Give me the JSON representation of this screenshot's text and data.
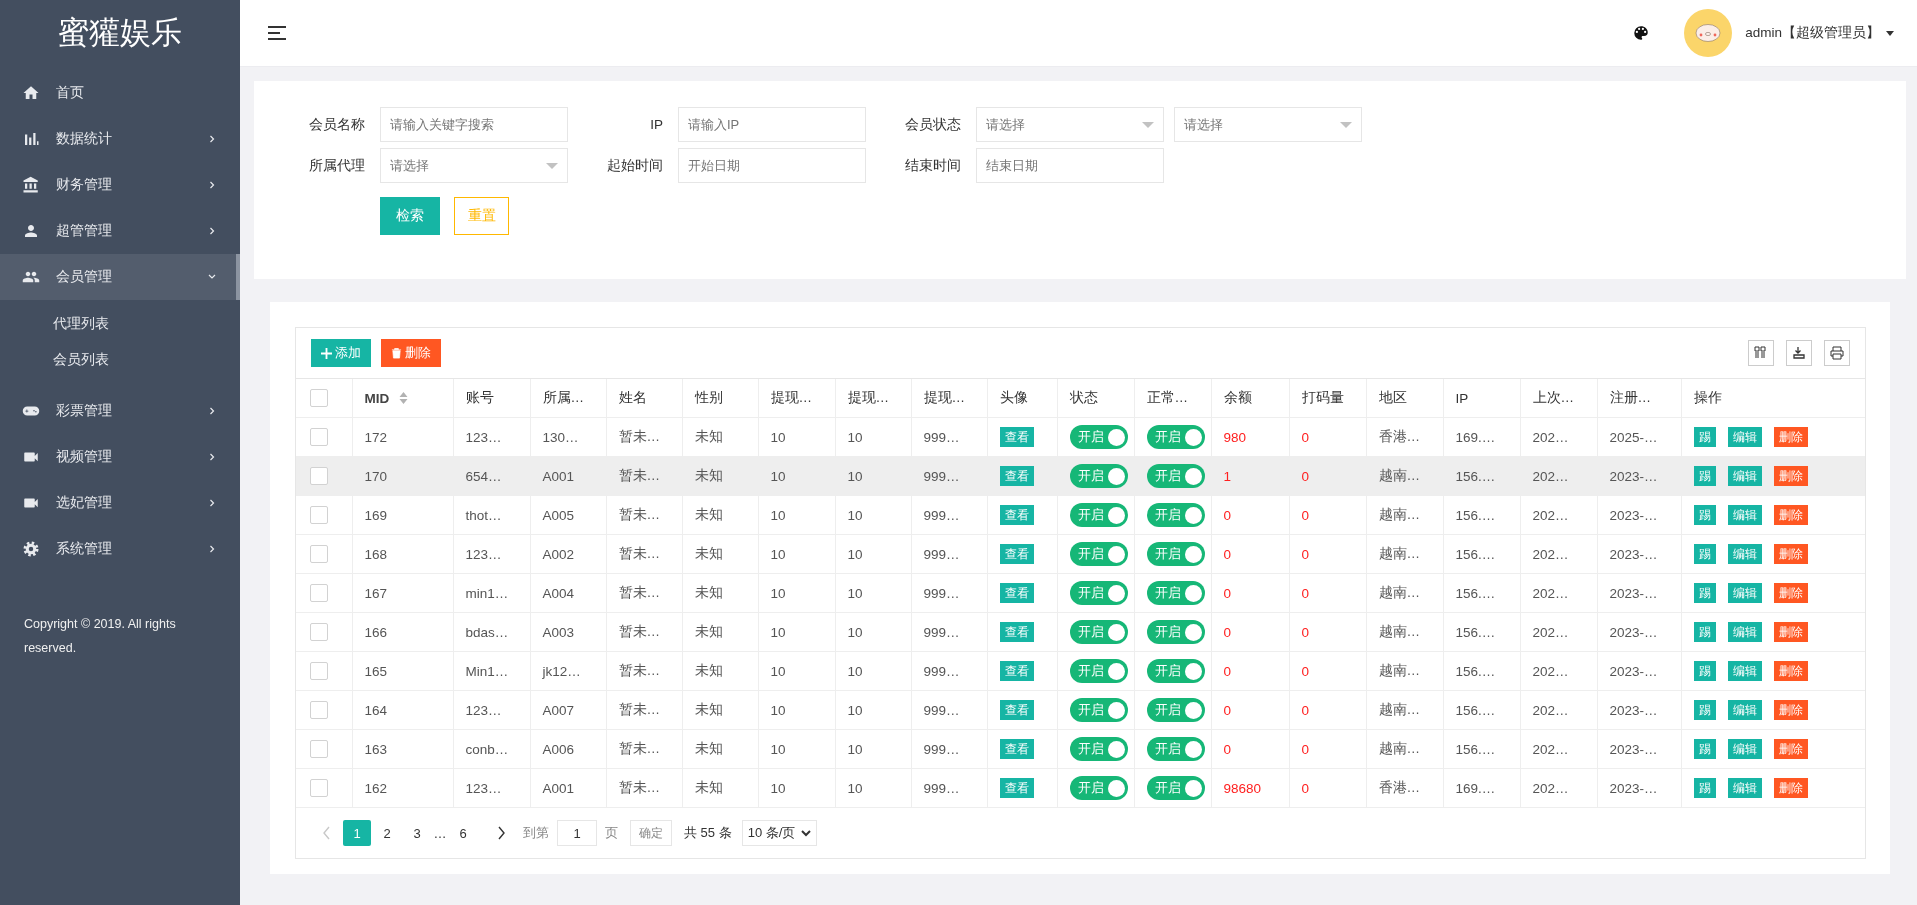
{
  "brand": "蜜獾娱乐",
  "sidebar": {
    "items": [
      {
        "kind": "home",
        "label": "首页",
        "selected": false
      },
      {
        "kind": "bar-chart",
        "label": "数据统计",
        "expanded": false,
        "selected": false
      },
      {
        "kind": "bank",
        "label": "财务管理",
        "expanded": false,
        "selected": false
      },
      {
        "kind": "user",
        "label": "超管管理",
        "expanded": false,
        "selected": false
      },
      {
        "kind": "users",
        "label": "会员管理",
        "expanded": true,
        "selected": true,
        "children": [
          {
            "label": "代理列表",
            "selected": false
          },
          {
            "label": "会员列表",
            "selected": false
          }
        ]
      },
      {
        "kind": "gamepad",
        "label": "彩票管理",
        "expanded": false,
        "selected": false
      },
      {
        "kind": "video",
        "label": "视频管理",
        "expanded": false,
        "selected": false
      },
      {
        "kind": "video",
        "label": "选妃管理",
        "expanded": false,
        "selected": false
      },
      {
        "kind": "gear",
        "label": "系统管理",
        "expanded": false,
        "selected": false
      }
    ],
    "copyright": "Copyright © 2019. All rights reserved."
  },
  "header": {
    "user": "admin【超级管理员】"
  },
  "filters": {
    "rows": [
      [
        {
          "label": "会员名称",
          "kind": "input",
          "placeholder": "请输入关键字搜索"
        },
        {
          "label": "IP",
          "kind": "input",
          "placeholder": "请输入IP"
        },
        {
          "label": "会员状态",
          "kind": "select",
          "placeholder": "请选择"
        },
        {
          "kind": "select",
          "placeholder": "请选择"
        }
      ],
      [
        {
          "label": "所属代理",
          "kind": "select",
          "placeholder": "请选择"
        },
        {
          "label": "起始时间",
          "kind": "input",
          "placeholder": "开始日期"
        },
        {
          "label": "结束时间",
          "kind": "input",
          "placeholder": "结束日期"
        }
      ]
    ],
    "buttons": [
      {
        "label": "检索",
        "kind": "primary"
      },
      {
        "label": "重置",
        "kind": "outline"
      }
    ]
  },
  "toolbar": {
    "buttons": [
      {
        "label": "添加",
        "kind": "add"
      },
      {
        "label": "删除",
        "kind": "delete"
      }
    ]
  },
  "table": {
    "header_checked": false,
    "columns": [
      {
        "label": "MID",
        "kind": "text",
        "sortable": true
      },
      {
        "label": "账号",
        "kind": "text"
      },
      {
        "label": "所属…",
        "kind": "text"
      },
      {
        "label": "姓名",
        "kind": "text"
      },
      {
        "label": "性别",
        "kind": "text"
      },
      {
        "label": "提现…",
        "kind": "text"
      },
      {
        "label": "提现…",
        "kind": "text"
      },
      {
        "label": "提现…",
        "kind": "text"
      },
      {
        "label": "头像",
        "kind": "button"
      },
      {
        "label": "状态",
        "kind": "toggle"
      },
      {
        "label": "正常…",
        "kind": "toggle"
      },
      {
        "label": "余额",
        "kind": "red"
      },
      {
        "label": "打码量",
        "kind": "red"
      },
      {
        "label": "地区",
        "kind": "text"
      },
      {
        "label": "IP",
        "kind": "text"
      },
      {
        "label": "上次…",
        "kind": "text"
      },
      {
        "label": "注册…",
        "kind": "text"
      },
      {
        "label": "操作",
        "kind": "actions"
      }
    ],
    "rows": [
      {
        "checked": false,
        "hovered": false,
        "cells": [
          "172",
          "123…",
          "130…",
          "暂未…",
          "未知",
          "10",
          "10",
          "999…",
          "查看",
          {
            "label": "开启",
            "on": true
          },
          {
            "label": "开启",
            "on": true
          },
          "980",
          "0",
          "香港…",
          "169.…",
          "202…",
          "2025-…",
          [
            {
              "label": "踢",
              "kind": "normal"
            },
            {
              "label": "编辑",
              "kind": "normal"
            },
            {
              "label": "删除",
              "kind": "danger"
            }
          ]
        ]
      },
      {
        "checked": false,
        "hovered": true,
        "cells": [
          "170",
          "654…",
          "A001",
          "暂未…",
          "未知",
          "10",
          "10",
          "999…",
          "查看",
          {
            "label": "开启",
            "on": true
          },
          {
            "label": "开启",
            "on": true
          },
          "1",
          "0",
          "越南…",
          "156.…",
          "202…",
          "2023-…",
          [
            {
              "label": "踢",
              "kind": "normal"
            },
            {
              "label": "编辑",
              "kind": "normal"
            },
            {
              "label": "删除",
              "kind": "danger"
            }
          ]
        ]
      },
      {
        "checked": false,
        "hovered": false,
        "cells": [
          "169",
          "thot…",
          "A005",
          "暂未…",
          "未知",
          "10",
          "10",
          "999…",
          "查看",
          {
            "label": "开启",
            "on": true
          },
          {
            "label": "开启",
            "on": true
          },
          "0",
          "0",
          "越南…",
          "156.…",
          "202…",
          "2023-…",
          [
            {
              "label": "踢",
              "kind": "normal"
            },
            {
              "label": "编辑",
              "kind": "normal"
            },
            {
              "label": "删除",
              "kind": "danger"
            }
          ]
        ]
      },
      {
        "checked": false,
        "hovered": false,
        "cells": [
          "168",
          "123…",
          "A002",
          "暂未…",
          "未知",
          "10",
          "10",
          "999…",
          "查看",
          {
            "label": "开启",
            "on": true
          },
          {
            "label": "开启",
            "on": true
          },
          "0",
          "0",
          "越南…",
          "156.…",
          "202…",
          "2023-…",
          [
            {
              "label": "踢",
              "kind": "normal"
            },
            {
              "label": "编辑",
              "kind": "normal"
            },
            {
              "label": "删除",
              "kind": "danger"
            }
          ]
        ]
      },
      {
        "checked": false,
        "hovered": false,
        "cells": [
          "167",
          "min1…",
          "A004",
          "暂未…",
          "未知",
          "10",
          "10",
          "999…",
          "查看",
          {
            "label": "开启",
            "on": true
          },
          {
            "label": "开启",
            "on": true
          },
          "0",
          "0",
          "越南…",
          "156.…",
          "202…",
          "2023-…",
          [
            {
              "label": "踢",
              "kind": "normal"
            },
            {
              "label": "编辑",
              "kind": "normal"
            },
            {
              "label": "删除",
              "kind": "danger"
            }
          ]
        ]
      },
      {
        "checked": false,
        "hovered": false,
        "cells": [
          "166",
          "bdas…",
          "A003",
          "暂未…",
          "未知",
          "10",
          "10",
          "999…",
          "查看",
          {
            "label": "开启",
            "on": true
          },
          {
            "label": "开启",
            "on": true
          },
          "0",
          "0",
          "越南…",
          "156.…",
          "202…",
          "2023-…",
          [
            {
              "label": "踢",
              "kind": "normal"
            },
            {
              "label": "编辑",
              "kind": "normal"
            },
            {
              "label": "删除",
              "kind": "danger"
            }
          ]
        ]
      },
      {
        "checked": false,
        "hovered": false,
        "cells": [
          "165",
          "Min1…",
          "jk12…",
          "暂未…",
          "未知",
          "10",
          "10",
          "999…",
          "查看",
          {
            "label": "开启",
            "on": true
          },
          {
            "label": "开启",
            "on": true
          },
          "0",
          "0",
          "越南…",
          "156.…",
          "202…",
          "2023-…",
          [
            {
              "label": "踢",
              "kind": "normal"
            },
            {
              "label": "编辑",
              "kind": "normal"
            },
            {
              "label": "删除",
              "kind": "danger"
            }
          ]
        ]
      },
      {
        "checked": false,
        "hovered": false,
        "cells": [
          "164",
          "123…",
          "A007",
          "暂未…",
          "未知",
          "10",
          "10",
          "999…",
          "查看",
          {
            "label": "开启",
            "on": true
          },
          {
            "label": "开启",
            "on": true
          },
          "0",
          "0",
          "越南…",
          "156.…",
          "202…",
          "2023-…",
          [
            {
              "label": "踢",
              "kind": "normal"
            },
            {
              "label": "编辑",
              "kind": "normal"
            },
            {
              "label": "删除",
              "kind": "danger"
            }
          ]
        ]
      },
      {
        "checked": false,
        "hovered": false,
        "cells": [
          "163",
          "conb…",
          "A006",
          "暂未…",
          "未知",
          "10",
          "10",
          "999…",
          "查看",
          {
            "label": "开启",
            "on": true
          },
          {
            "label": "开启",
            "on": true
          },
          "0",
          "0",
          "越南…",
          "156.…",
          "202…",
          "2023-…",
          [
            {
              "label": "踢",
              "kind": "normal"
            },
            {
              "label": "编辑",
              "kind": "normal"
            },
            {
              "label": "删除",
              "kind": "danger"
            }
          ]
        ]
      },
      {
        "checked": false,
        "hovered": false,
        "cells": [
          "162",
          "123…",
          "A001",
          "暂未…",
          "未知",
          "10",
          "10",
          "999…",
          "查看",
          {
            "label": "开启",
            "on": true
          },
          {
            "label": "开启",
            "on": true
          },
          "98680",
          "0",
          "香港…",
          "169.…",
          "202…",
          "2023-…",
          [
            {
              "label": "踢",
              "kind": "normal"
            },
            {
              "label": "编辑",
              "kind": "normal"
            },
            {
              "label": "删除",
              "kind": "danger"
            }
          ]
        ]
      }
    ]
  },
  "pagination": {
    "pages": [
      {
        "label": "1",
        "selected": true
      },
      {
        "label": "2",
        "selected": false
      },
      {
        "label": "3",
        "selected": false
      },
      {
        "label": "…",
        "kind": "gap"
      },
      {
        "label": "6",
        "selected": false
      }
    ],
    "prev_disabled": true,
    "goto_label": "到第",
    "goto_value": "1",
    "page_unit": "页",
    "confirm": "确定",
    "total": "共 55 条",
    "page_size": "10 条/页"
  }
}
